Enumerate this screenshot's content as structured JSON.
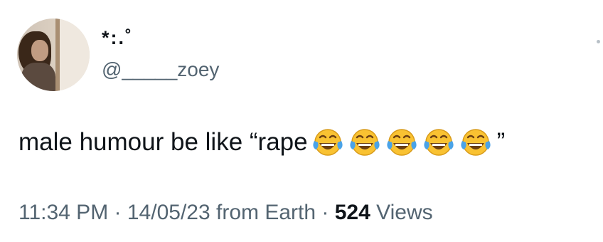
{
  "tweet": {
    "display_name": "*:.˚",
    "handle": "@_____zoey",
    "text": "male humour be like “rape",
    "emoji_name": "face-with-tears-of-joy",
    "emoji_count": 5,
    "closing_quote": "”",
    "time": "11:34 PM",
    "separator": "·",
    "date": "14/05/23",
    "source": "from Earth",
    "views_count": "524",
    "views_label": "Views"
  },
  "colors": {
    "text_primary": "#0f1419",
    "text_secondary": "#536471",
    "background": "#ffffff",
    "emoji_face": "#f9c232",
    "emoji_tears": "#4aa3e8"
  },
  "icons": {
    "avatar": "profile-photo",
    "emoji": "face-with-tears-of-joy"
  }
}
